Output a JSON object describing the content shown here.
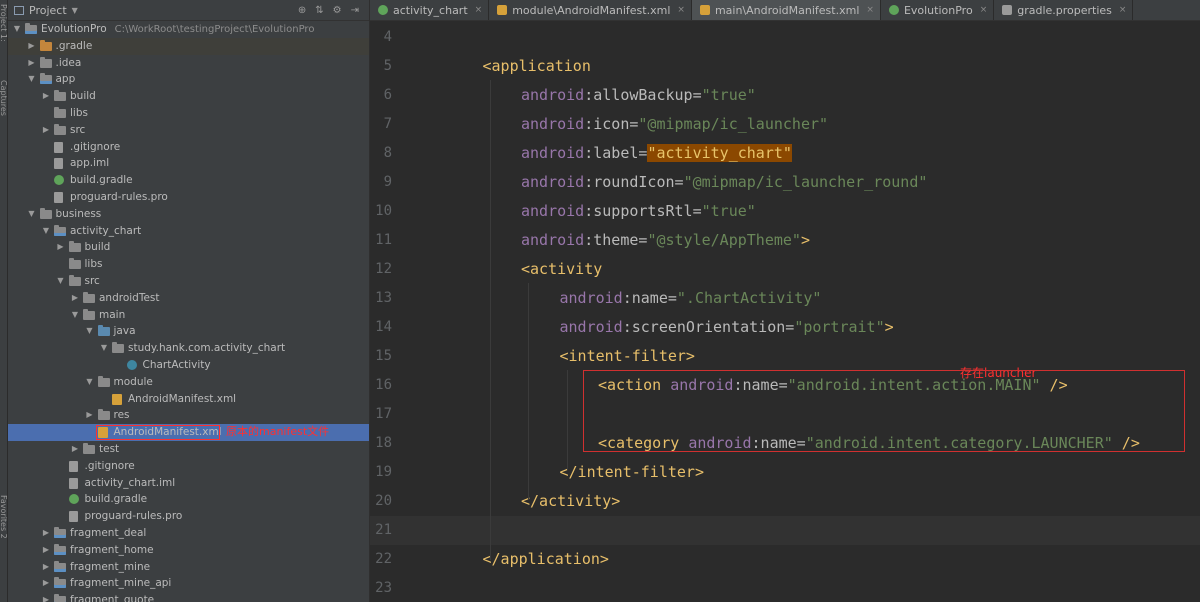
{
  "side_strip": {
    "top_label": "Project 1:",
    "mid_label": "Captures",
    "bottom_label": "Favorites 2"
  },
  "project_panel": {
    "title": "Project",
    "tree": [
      {
        "indent": 0,
        "arrow": "down",
        "icon": "module-folder",
        "label": "EvolutionPro",
        "path": "C:\\WorkRoot\\testingProject\\EvolutionPro"
      },
      {
        "indent": 1,
        "arrow": "right",
        "icon": "orange-folder",
        "label": ".gradle",
        "style": "gradle-dim"
      },
      {
        "indent": 1,
        "arrow": "right",
        "icon": "folder",
        "label": ".idea"
      },
      {
        "indent": 1,
        "arrow": "down",
        "icon": "module-folder",
        "label": "app"
      },
      {
        "indent": 2,
        "arrow": "right",
        "icon": "folder",
        "label": "build"
      },
      {
        "indent": 2,
        "arrow": "none",
        "icon": "folder",
        "label": "libs"
      },
      {
        "indent": 2,
        "arrow": "right",
        "icon": "folder",
        "label": "src"
      },
      {
        "indent": 2,
        "arrow": "none",
        "icon": "file",
        "label": ".gitignore"
      },
      {
        "indent": 2,
        "arrow": "none",
        "icon": "file",
        "label": "app.iml"
      },
      {
        "indent": 2,
        "arrow": "none",
        "icon": "gradle-file",
        "label": "build.gradle"
      },
      {
        "indent": 2,
        "arrow": "none",
        "icon": "file",
        "label": "proguard-rules.pro"
      },
      {
        "indent": 1,
        "arrow": "down",
        "icon": "folder",
        "label": "business"
      },
      {
        "indent": 2,
        "arrow": "down",
        "icon": "module-folder",
        "label": "activity_chart"
      },
      {
        "indent": 3,
        "arrow": "right",
        "icon": "folder",
        "label": "build"
      },
      {
        "indent": 3,
        "arrow": "none",
        "icon": "folder",
        "label": "libs"
      },
      {
        "indent": 3,
        "arrow": "down",
        "icon": "folder",
        "label": "src"
      },
      {
        "indent": 4,
        "arrow": "right",
        "icon": "folder",
        "label": "androidTest"
      },
      {
        "indent": 4,
        "arrow": "down",
        "icon": "folder",
        "label": "main"
      },
      {
        "indent": 5,
        "arrow": "down",
        "icon": "blue-folder",
        "label": "java"
      },
      {
        "indent": 6,
        "arrow": "down",
        "icon": "folder",
        "label": "study.hank.com.activity_chart"
      },
      {
        "indent": 7,
        "arrow": "none",
        "icon": "class-file",
        "label": "ChartActivity"
      },
      {
        "indent": 5,
        "arrow": "down",
        "icon": "folder",
        "label": "module"
      },
      {
        "indent": 6,
        "arrow": "none",
        "icon": "xml-file",
        "label": "AndroidManifest.xml"
      },
      {
        "indent": 5,
        "arrow": "right",
        "icon": "folder",
        "label": "res"
      },
      {
        "indent": 5,
        "arrow": "none",
        "icon": "xml-file",
        "label": "AndroidManifest.xml",
        "style": "selected",
        "annotation": "原本的manifest文件"
      },
      {
        "indent": 4,
        "arrow": "right",
        "icon": "folder",
        "label": "test"
      },
      {
        "indent": 3,
        "arrow": "none",
        "icon": "file",
        "label": ".gitignore"
      },
      {
        "indent": 3,
        "arrow": "none",
        "icon": "file",
        "label": "activity_chart.iml"
      },
      {
        "indent": 3,
        "arrow": "none",
        "icon": "gradle-file",
        "label": "build.gradle"
      },
      {
        "indent": 3,
        "arrow": "none",
        "icon": "file",
        "label": "proguard-rules.pro"
      },
      {
        "indent": 2,
        "arrow": "right",
        "icon": "module-folder",
        "label": "fragment_deal"
      },
      {
        "indent": 2,
        "arrow": "right",
        "icon": "module-folder",
        "label": "fragment_home"
      },
      {
        "indent": 2,
        "arrow": "right",
        "icon": "module-folder",
        "label": "fragment_mine"
      },
      {
        "indent": 2,
        "arrow": "right",
        "icon": "module-folder",
        "label": "fragment_mine_api"
      },
      {
        "indent": 2,
        "arrow": "right",
        "icon": "module-folder",
        "label": "fragment_quote"
      }
    ]
  },
  "editor": {
    "tabs": [
      {
        "label": "activity_chart",
        "icon": "gradle",
        "active": false
      },
      {
        "label": "module\\AndroidManifest.xml",
        "icon": "xml",
        "active": false
      },
      {
        "label": "main\\AndroidManifest.xml",
        "icon": "xml",
        "active": true
      },
      {
        "label": "EvolutionPro",
        "icon": "gradle",
        "active": false
      },
      {
        "label": "gradle.properties",
        "icon": "file",
        "active": false
      }
    ],
    "lines": [
      {
        "n": "4",
        "indent": 0,
        "tokens": []
      },
      {
        "n": "5",
        "indent": 1,
        "tokens": [
          [
            "tag",
            "<application"
          ]
        ]
      },
      {
        "n": "6",
        "indent": 2,
        "tokens": [
          [
            "ns",
            "android"
          ],
          [
            "attr",
            ":allowBackup="
          ],
          [
            "val",
            "\"true\""
          ]
        ]
      },
      {
        "n": "7",
        "indent": 2,
        "tokens": [
          [
            "ns",
            "android"
          ],
          [
            "attr",
            ":icon="
          ],
          [
            "val",
            "\"@mipmap/ic_launcher\""
          ]
        ]
      },
      {
        "n": "8",
        "indent": 2,
        "tokens": [
          [
            "ns",
            "android"
          ],
          [
            "attr",
            ":label="
          ],
          [
            "hl",
            "\"activity_chart\""
          ]
        ]
      },
      {
        "n": "9",
        "indent": 2,
        "tokens": [
          [
            "ns",
            "android"
          ],
          [
            "attr",
            ":roundIcon="
          ],
          [
            "val",
            "\"@mipmap/ic_launcher_round\""
          ]
        ]
      },
      {
        "n": "10",
        "indent": 2,
        "tokens": [
          [
            "ns",
            "android"
          ],
          [
            "attr",
            ":supportsRtl="
          ],
          [
            "val",
            "\"true\""
          ]
        ]
      },
      {
        "n": "11",
        "indent": 2,
        "tokens": [
          [
            "ns",
            "android"
          ],
          [
            "attr",
            ":theme="
          ],
          [
            "val",
            "\"@style/AppTheme\""
          ],
          [
            "tag",
            ">"
          ]
        ]
      },
      {
        "n": "12",
        "indent": 2,
        "tokens": [
          [
            "tag",
            "<activity"
          ]
        ]
      },
      {
        "n": "13",
        "indent": 3,
        "tokens": [
          [
            "ns",
            "android"
          ],
          [
            "attr",
            ":name="
          ],
          [
            "val",
            "\".ChartActivity\""
          ]
        ]
      },
      {
        "n": "14",
        "indent": 3,
        "tokens": [
          [
            "ns",
            "android"
          ],
          [
            "attr",
            ":screenOrientation="
          ],
          [
            "val",
            "\"portrait\""
          ],
          [
            "tag",
            ">"
          ]
        ]
      },
      {
        "n": "15",
        "indent": 3,
        "tokens": [
          [
            "tag",
            "<intent-filter>"
          ]
        ]
      },
      {
        "n": "16",
        "indent": 4,
        "tokens": [
          [
            "tag",
            "<action "
          ],
          [
            "ns",
            "android"
          ],
          [
            "attr",
            ":name="
          ],
          [
            "val",
            "\"android.intent.action.MAIN\""
          ],
          [
            "tag",
            " />"
          ]
        ]
      },
      {
        "n": "17",
        "indent": 4,
        "tokens": []
      },
      {
        "n": "18",
        "indent": 4,
        "tokens": [
          [
            "tag",
            "<category "
          ],
          [
            "ns",
            "android"
          ],
          [
            "attr",
            ":name="
          ],
          [
            "val",
            "\"android.intent.category.LAUNCHER\""
          ],
          [
            "tag",
            " />"
          ]
        ]
      },
      {
        "n": "19",
        "indent": 3,
        "tokens": [
          [
            "tag",
            "</intent-filter>"
          ]
        ]
      },
      {
        "n": "20",
        "indent": 2,
        "tokens": [
          [
            "tag",
            "</activity>"
          ]
        ]
      },
      {
        "n": "21",
        "indent": 0,
        "tokens": [],
        "current": true
      },
      {
        "n": "22",
        "indent": 1,
        "tokens": [
          [
            "tag",
            "</application>"
          ]
        ]
      },
      {
        "n": "23",
        "indent": 0,
        "tokens": []
      }
    ],
    "launcher_note": "存在launcher"
  }
}
